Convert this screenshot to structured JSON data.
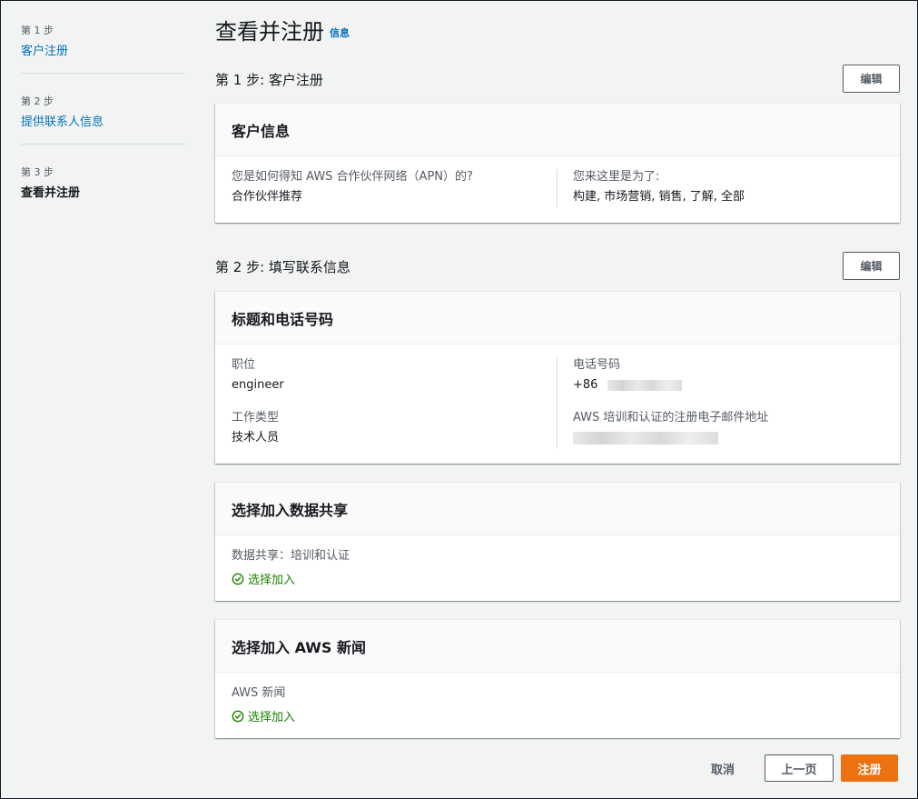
{
  "colors": {
    "link": "#0073bb",
    "primary_button": "#ec7211",
    "success": "#1d8102",
    "background": "#f2f3f3"
  },
  "sidebar": {
    "steps": [
      {
        "num": "第 1 步",
        "label": "客户注册"
      },
      {
        "num": "第 2 步",
        "label": "提供联系人信息"
      },
      {
        "num": "第 3 步",
        "label": "查看并注册"
      }
    ]
  },
  "page": {
    "title": "查看并注册",
    "info_link": "信息"
  },
  "step1": {
    "heading": "第 1 步: 客户注册",
    "edit_label": "编辑",
    "panel_title": "客户信息",
    "left_label": "您是如何得知 AWS 合作伙伴网络（APN）的?",
    "left_value": "合作伙伴推荐",
    "right_label": "您来这里是为了:",
    "right_value": "构建, 市场营销, 销售, 了解, 全部"
  },
  "step2": {
    "heading": "第 2 步: 填写联系信息",
    "edit_label": "编辑",
    "panel_title": "标题和电话号码",
    "job_title_label": "职位",
    "job_title_value": "engineer",
    "job_type_label": "工作类型",
    "job_type_value": "技术人员",
    "phone_label": "电话号码",
    "phone_prefix": "+86",
    "email_label": "AWS 培训和认证的注册电子邮件地址"
  },
  "data_sharing": {
    "panel_title": "选择加入数据共享",
    "label": "数据共享：培训和认证",
    "status": "选择加入"
  },
  "aws_news": {
    "panel_title": "选择加入 AWS 新闻",
    "label": "AWS 新闻",
    "status": "选择加入"
  },
  "footer": {
    "cancel_label": "取消",
    "prev_label": "上一页",
    "submit_label": "注册"
  }
}
